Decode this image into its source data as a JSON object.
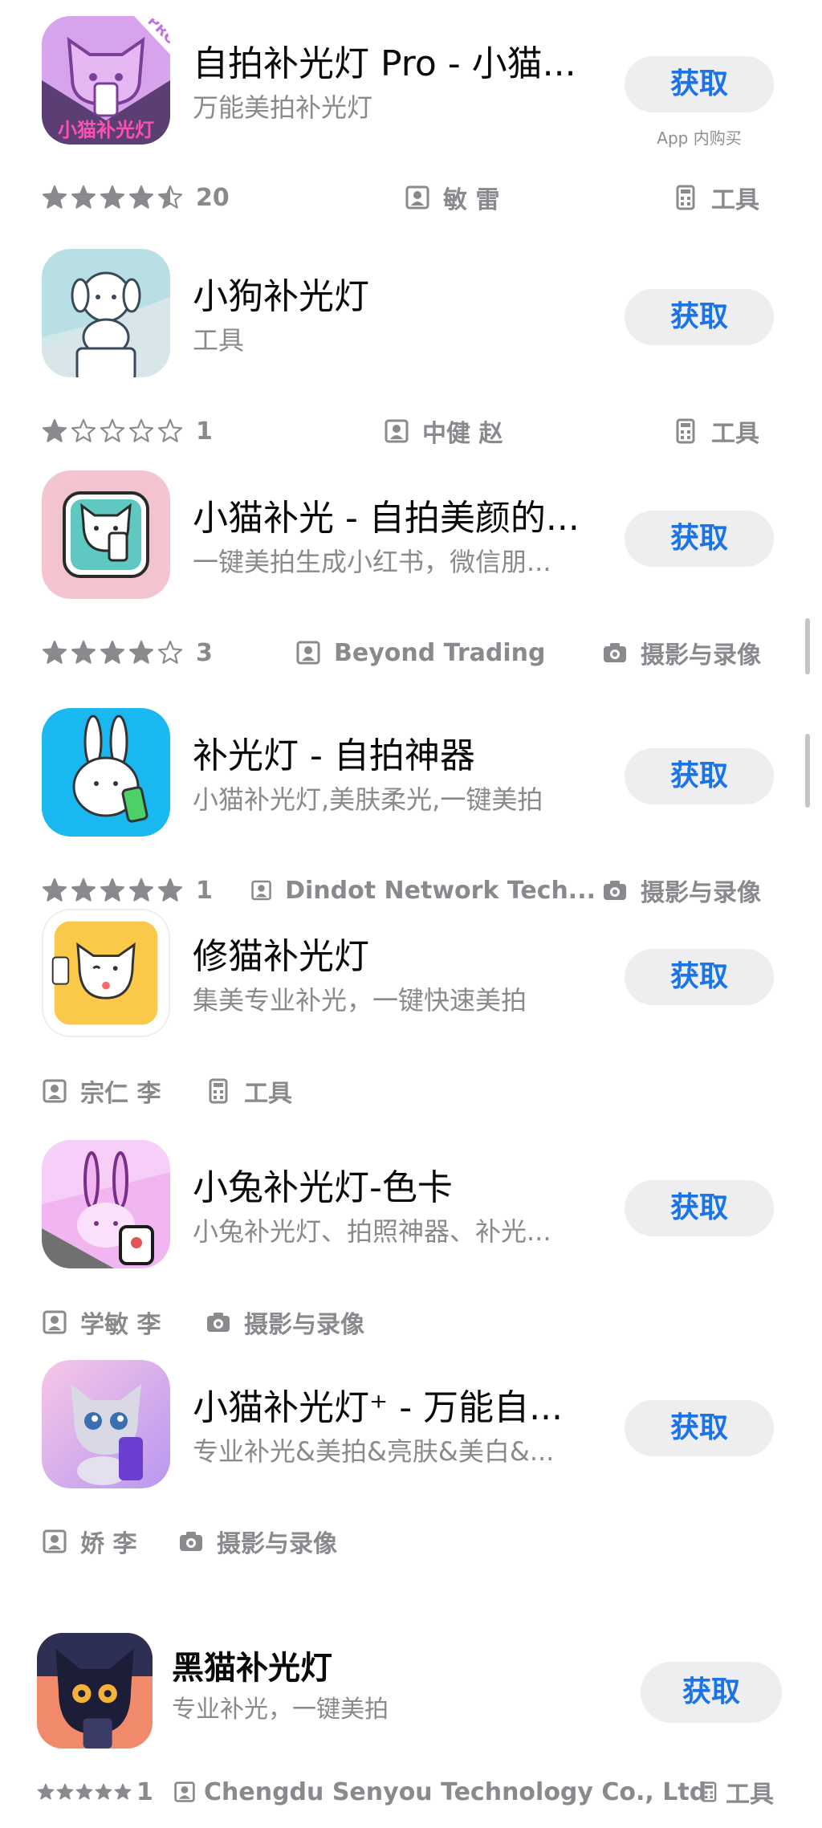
{
  "get_label": "获取",
  "in_app_purchase": "App 内购买",
  "apps": [
    {
      "title": "自拍补光灯 Pro - 小猫...",
      "subtitle": "万能美拍补光灯",
      "rating": 4.5,
      "rating_count": "20",
      "developer": "敏 雷",
      "category": "工具",
      "category_icon": "calculator-icon",
      "icon_text": "小猫补光灯",
      "icon_badge": "PRO"
    },
    {
      "title": "小狗补光灯",
      "subtitle": "工具",
      "rating": 1,
      "rating_count": "1",
      "developer": "中健 赵",
      "category": "工具",
      "category_icon": "calculator-icon"
    },
    {
      "title": "小猫补光 - 自拍美颜的...",
      "subtitle": "一键美拍生成小红书，微信朋...",
      "rating": 4,
      "rating_count": "3",
      "developer": "Beyond Trading",
      "category": "摄影与录像",
      "category_icon": "camera-icon"
    },
    {
      "title": "补光灯 - 自拍神器",
      "subtitle": "小猫补光灯,美肤柔光,一键美拍",
      "rating": 5,
      "rating_count": "1",
      "developer": "Dindot Network Tech...",
      "category": "摄影与录像",
      "category_icon": "camera-icon"
    },
    {
      "title": "修猫补光灯",
      "subtitle": "集美专业补光，一键快速美拍",
      "developer": "宗仁 李",
      "category": "工具",
      "category_icon": "calculator-icon"
    },
    {
      "title": "小兔补光灯-色卡",
      "subtitle": "小兔补光灯、拍照神器、补光...",
      "developer": "学敏 李",
      "category": "摄影与录像",
      "category_icon": "camera-icon"
    },
    {
      "title": "小猫补光灯⁺ - 万能自...",
      "subtitle": "专业补光&美拍&亮肤&美白&...",
      "developer": "娇 李",
      "category": "摄影与录像",
      "category_icon": "camera-icon"
    },
    {
      "title": "黑猫补光灯",
      "subtitle": "专业补光，一键美拍",
      "rating": 5,
      "rating_count": "1",
      "developer": "Chengdu Senyou Technology Co., Ltd",
      "category": "工具",
      "category_icon": "calculator-icon"
    }
  ],
  "colors": {
    "accent": "#1a73e8",
    "button_bg": "#eeeef0",
    "secondary_text": "#8a8a8e"
  }
}
